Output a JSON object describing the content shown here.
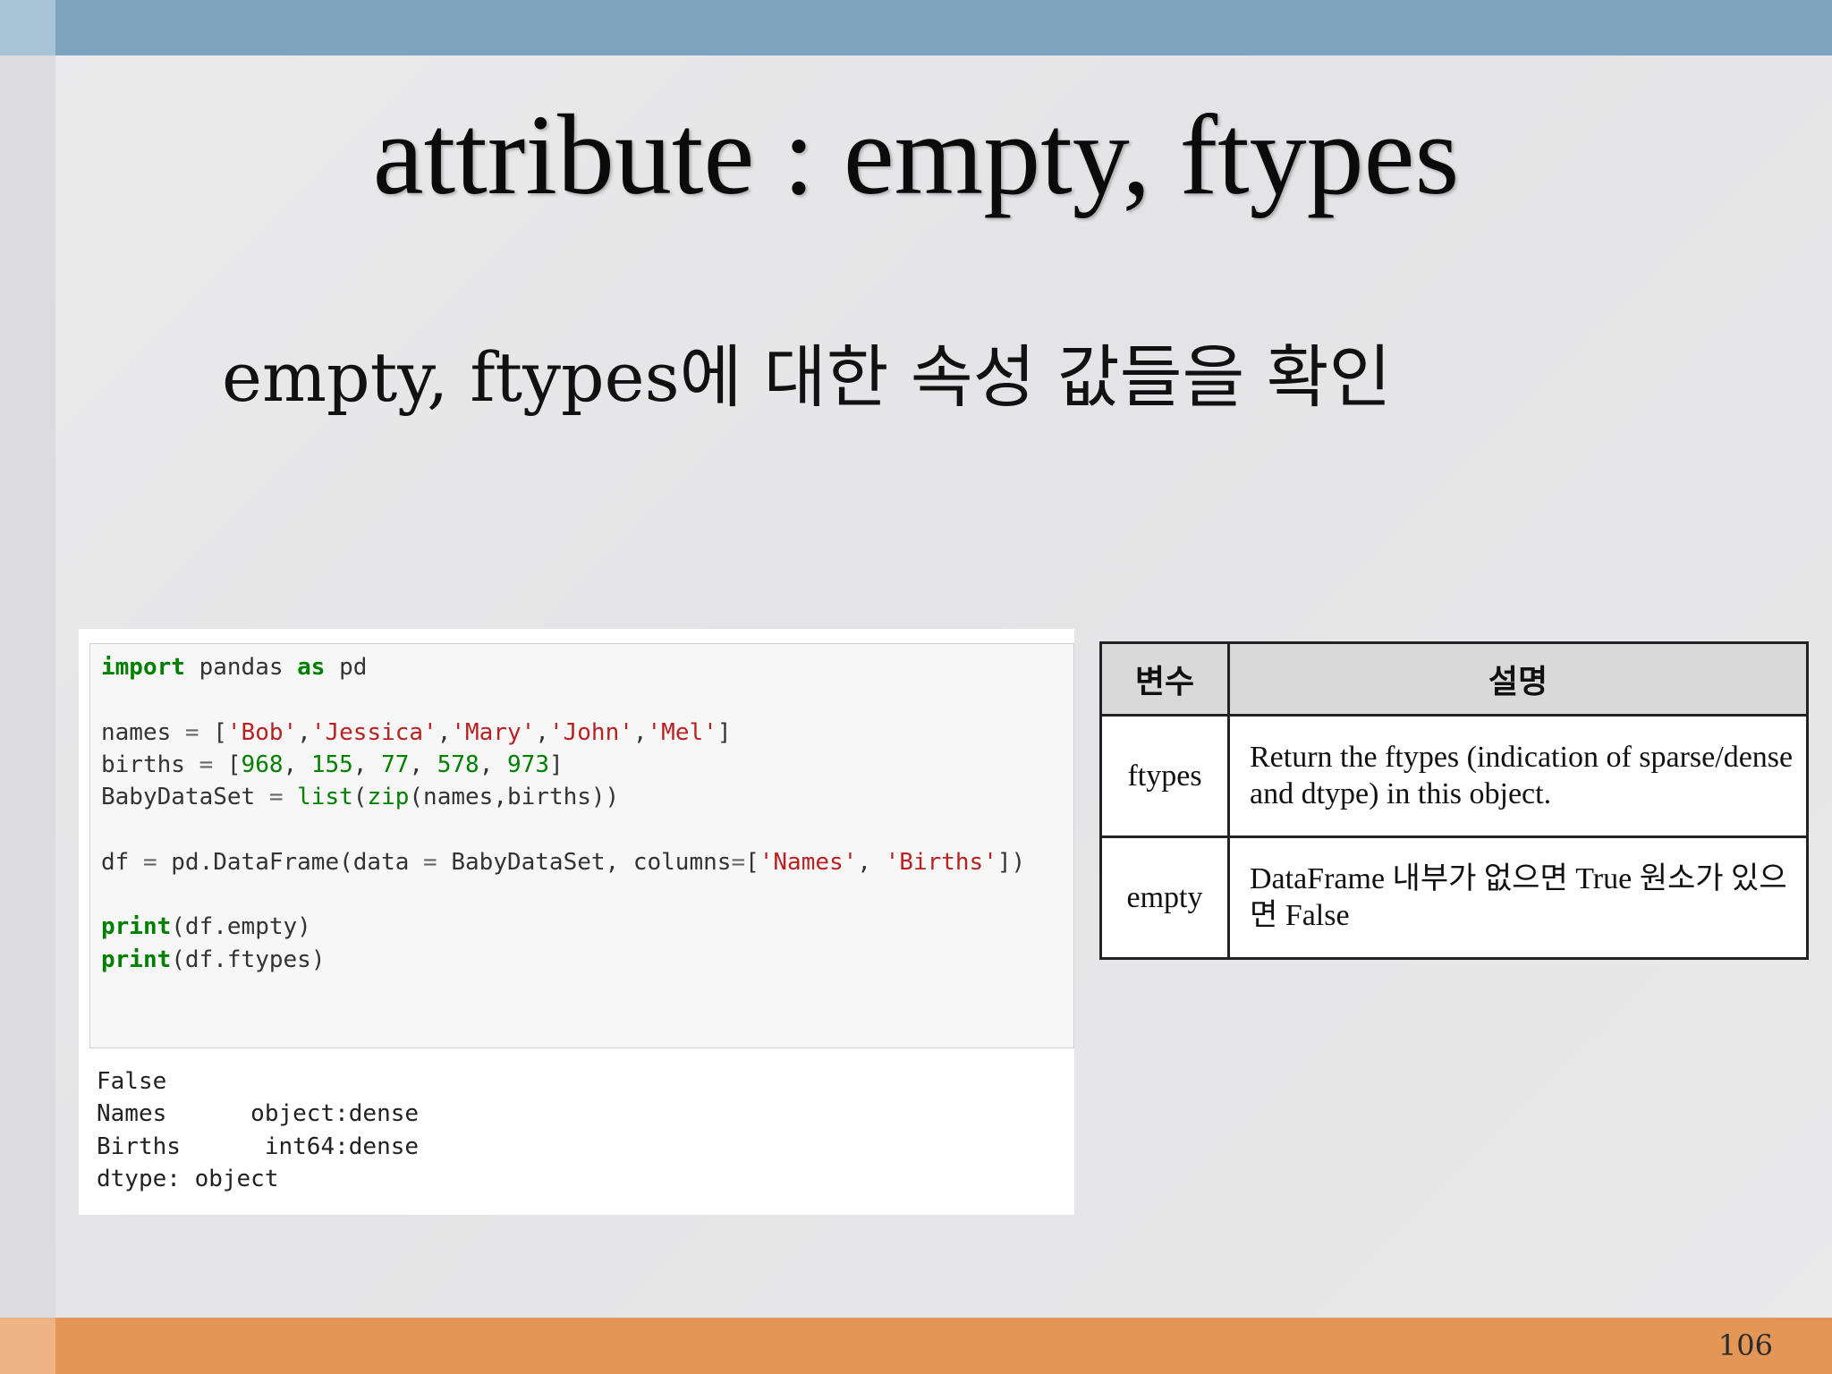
{
  "slide": {
    "title": "attribute : empty, ftypes",
    "subtitle": "empty, ftypes에 대한 속성 값들을 확인",
    "page_number": "106"
  },
  "code": {
    "lines": [
      "import pandas as pd",
      "",
      "names = ['Bob','Jessica','Mary','John','Mel']",
      "births = [968, 155, 77, 578, 973]",
      "BabyDataSet = list(zip(names,births))",
      "",
      "df = pd.DataFrame(data = BabyDataSet, columns=['Names', 'Births'])",
      "",
      "print(df.empty)",
      "print(df.ftypes)"
    ],
    "output": [
      "False",
      "Names      object:dense",
      "Births      int64:dense",
      "dtype: object"
    ]
  },
  "table": {
    "headers": [
      "변수",
      "설명"
    ],
    "rows": [
      {
        "name": "ftypes",
        "description": "Return the ftypes (indication of sparse/dense and dtype) in this object."
      },
      {
        "name": "empty",
        "description": "DataFrame 내부가 없으면 True  원소가 있으면 False"
      }
    ]
  },
  "colors": {
    "top_bar": "#7ea3bf",
    "bottom_bar": "#e39656",
    "keyword_green": "#008000",
    "string_red": "#ba2121"
  }
}
